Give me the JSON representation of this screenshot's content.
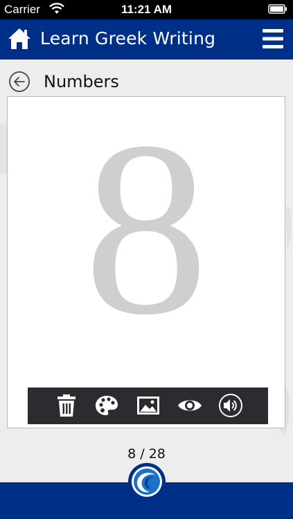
{
  "status_bar": {
    "carrier": "Carrier",
    "time": "11:21 AM",
    "wifi_icon": "wifi-icon",
    "battery_icon": "battery-icon"
  },
  "header": {
    "title": "Learn Greek Writing",
    "home_icon": "home-icon",
    "menu_icon": "hamburger-menu-icon",
    "background": "#002f87"
  },
  "section": {
    "title": "Numbers",
    "back_icon": "back-arrow-icon"
  },
  "card": {
    "glyph": "8",
    "glyph_color": "#cfcfcf"
  },
  "toolbar": {
    "tools": [
      "trash-icon",
      "palette-icon",
      "image-icon",
      "eye-icon",
      "speaker-icon"
    ],
    "background": "#2b2b30"
  },
  "pager": {
    "counter": "8 / 28"
  },
  "footer": {
    "logo_icon": "app-logo-icon",
    "background": "#002f87"
  }
}
